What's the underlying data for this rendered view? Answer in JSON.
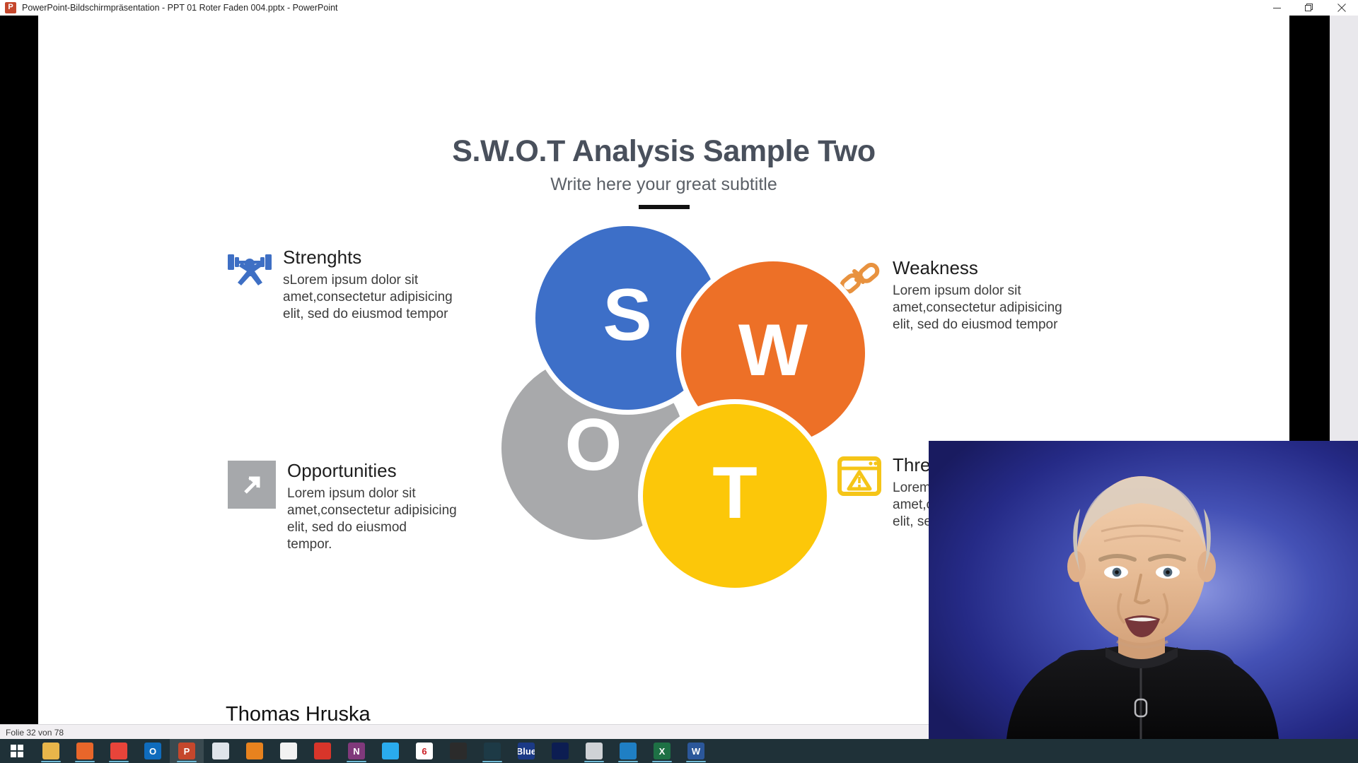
{
  "window": {
    "app_icon": "powerpoint-icon",
    "title": "PowerPoint-Bildschirmpräsentation  -  PPT 01 Roter Faden 004.pptx - PowerPoint",
    "controls": {
      "minimize": "minimize-icon",
      "restore": "restore-icon",
      "close": "close-icon"
    }
  },
  "slide": {
    "title": "S.W.O.T Analysis Sample Two",
    "subtitle": "Write here your great subtitle",
    "footer_name": "Thomas Hruska",
    "diagram": {
      "letters": [
        {
          "key": "S",
          "label": "S",
          "color": "#3d6fc8",
          "meaning": "strengths"
        },
        {
          "key": "W",
          "label": "W",
          "color": "#ed7027",
          "meaning": "weakness"
        },
        {
          "key": "O",
          "label": "O",
          "color": "#a8a9ab",
          "meaning": "opportunities"
        },
        {
          "key": "T",
          "label": "T",
          "color": "#fcc709",
          "meaning": "threats"
        }
      ]
    },
    "quadrants": {
      "strengths": {
        "heading": "Strenghts",
        "icon": "weightlifter-icon",
        "icon_color": "#3e6fc4",
        "body_lines": [
          "sLorem ipsum dolor sit",
          "amet,consectetur adipisicing",
          "elit, sed do eiusmod tempor"
        ]
      },
      "weakness": {
        "heading": "Weakness",
        "icon": "broken-chain-icon",
        "icon_color": "#e8923f",
        "body_lines": [
          "Lorem ipsum dolor sit",
          "amet,consectetur adipisicing",
          "elit, sed do eiusmod tempor"
        ]
      },
      "opportunities": {
        "heading": "Opportunities",
        "icon": "arrow-up-right-icon",
        "icon_color": "#a6a8ab",
        "body_lines": [
          "Lorem ipsum dolor sit",
          "amet,consectetur adipisicing",
          "elit, sed do eiusmod",
          "tempor."
        ]
      },
      "threats": {
        "heading": "Threats",
        "icon": "warning-window-icon",
        "icon_color": "#f5c518",
        "body_lines": [
          "Lorem ipsum dolor sit",
          "amet,consectetur adipisicing",
          "elit, sed do eiusmod tempor"
        ]
      }
    }
  },
  "status_bar": {
    "slide_counter": "Folie 32 von 78"
  },
  "taskbar": {
    "start": "windows-start-icon",
    "items": [
      {
        "name": "file-explorer-icon",
        "label": "",
        "bg": "#e8b54a",
        "fg": "#ffffff",
        "running": true
      },
      {
        "name": "firefox-icon",
        "label": "",
        "bg": "#e8662a",
        "fg": "#ffffff",
        "running": true
      },
      {
        "name": "chrome-icon",
        "label": "",
        "bg": "#e8443a",
        "fg": "#ffffff",
        "running": true
      },
      {
        "name": "outlook-icon",
        "label": "O",
        "bg": "#0f6cbd",
        "fg": "#ffffff",
        "running": false
      },
      {
        "name": "powerpoint-icon",
        "label": "P",
        "bg": "#c5472c",
        "fg": "#ffffff",
        "running": true,
        "active": true
      },
      {
        "name": "snipping-tool-icon",
        "label": "",
        "bg": "#dfe4ea",
        "fg": "#2a6fb0",
        "running": false
      },
      {
        "name": "vlc-icon",
        "label": "",
        "bg": "#e8821e",
        "fg": "#ffffff",
        "running": false
      },
      {
        "name": "photos-icon",
        "label": "",
        "bg": "#f2f2f2",
        "fg": "#d08a2a",
        "running": false
      },
      {
        "name": "lips-app-icon",
        "label": "",
        "bg": "#d8352a",
        "fg": "#ffffff",
        "running": false
      },
      {
        "name": "onenote-icon",
        "label": "N",
        "bg": "#80397b",
        "fg": "#ffffff",
        "running": true
      },
      {
        "name": "telegram-icon",
        "label": "",
        "bg": "#2aabee",
        "fg": "#ffffff",
        "running": false
      },
      {
        "name": "camtasia-icon",
        "label": "6",
        "bg": "#ffffff",
        "fg": "#cc2027",
        "running": false
      },
      {
        "name": "obs-studio-icon",
        "label": "",
        "bg": "#2b2b2b",
        "fg": "#dddddd",
        "running": false
      },
      {
        "name": "screen-recorder-icon",
        "label": "",
        "bg": "#1d3a46",
        "fg": "#74b6cf",
        "running": true
      },
      {
        "name": "bluejeans-icon",
        "label": "Blue",
        "bg": "#1b3a86",
        "fg": "#ffffff",
        "running": false
      },
      {
        "name": "video-editor-icon",
        "label": "",
        "bg": "#0c1d52",
        "fg": "#ffffff",
        "running": false
      },
      {
        "name": "irfanview-icon",
        "label": "",
        "bg": "#cfd2d6",
        "fg": "#333333",
        "running": true
      },
      {
        "name": "edge-icon",
        "label": "",
        "bg": "#1f7fc4",
        "fg": "#ffffff",
        "running": true
      },
      {
        "name": "excel-icon",
        "label": "X",
        "bg": "#1e7145",
        "fg": "#ffffff",
        "running": true
      },
      {
        "name": "word-icon",
        "label": "W",
        "bg": "#2b579a",
        "fg": "#ffffff",
        "running": true
      }
    ]
  },
  "webcam_overlay": {
    "name": "presenter-webcam-video",
    "description": "Presenter on blue gradient background"
  }
}
